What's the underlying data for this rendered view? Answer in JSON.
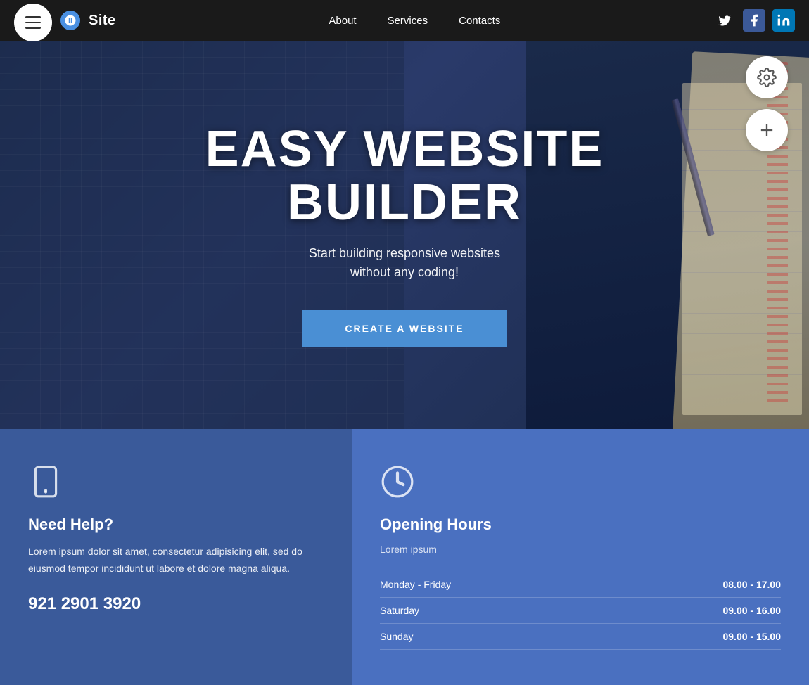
{
  "navbar": {
    "site_name": "Site",
    "nav_links": [
      "About",
      "Services",
      "Contacts"
    ],
    "social": [
      "twitter",
      "facebook",
      "linkedin"
    ]
  },
  "hero": {
    "title_line1": "EASY WEBSITE",
    "title_line2": "BUILDER",
    "subtitle_line1": "Start building responsive websites",
    "subtitle_line2": "without any coding!",
    "cta_label": "CREATE A WEBSITE"
  },
  "cards": {
    "left": {
      "title": "Need Help?",
      "description": "Lorem ipsum dolor sit amet, consectetur adipisicing elit, sed do eiusmod tempor incididunt ut labore et dolore magna aliqua.",
      "phone": "921 2901 3920"
    },
    "right": {
      "title": "Opening Hours",
      "subtitle": "Lorem ipsum",
      "hours": [
        {
          "day": "Monday - Friday",
          "time": "08.00 - 17.00"
        },
        {
          "day": "Saturday",
          "time": "09.00 - 16.00"
        },
        {
          "day": "Sunday",
          "time": "09.00 - 15.00"
        }
      ]
    }
  }
}
